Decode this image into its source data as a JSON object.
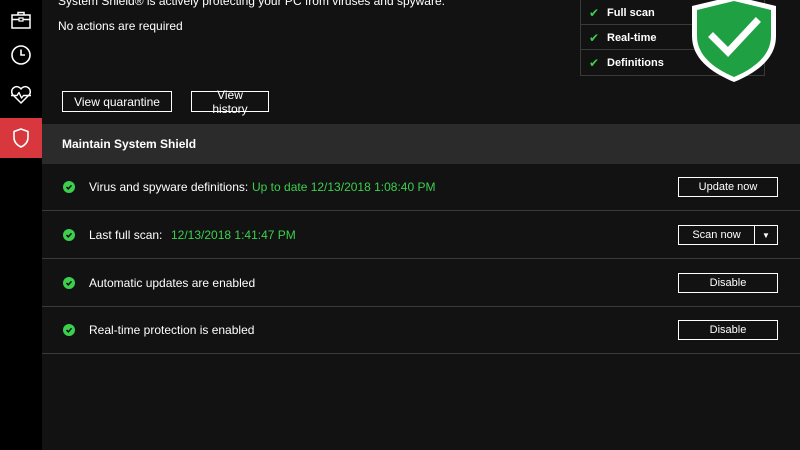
{
  "sidebar": {
    "items": [
      {
        "icon": "briefcase-icon"
      },
      {
        "icon": "clock-icon"
      },
      {
        "icon": "heartbeat-icon"
      },
      {
        "icon": "shield-icon",
        "active": true
      }
    ],
    "active_color": "#d7373d"
  },
  "status": {
    "headline": "System Shield® is actively protecting your PC from viruses and spyware.",
    "subline": "No actions are required"
  },
  "actions": {
    "view_quarantine": "View quarantine",
    "view_history": "View history"
  },
  "checklist": {
    "items": [
      "Full scan",
      "Real-time",
      "Definitions"
    ],
    "check_color": "#3ccf4e"
  },
  "section": {
    "title": "Maintain System Shield"
  },
  "rows": [
    {
      "label": "Virus and spyware definitions:",
      "value": "Up to date 12/13/2018 1:08:40 PM",
      "button": "Update now"
    },
    {
      "label": "Last full scan:",
      "value": "12/13/2018 1:41:47 PM",
      "button": "Scan now",
      "dropdown_arrow": "▼"
    },
    {
      "label": "Automatic updates are enabled",
      "value": "",
      "button": "Disable"
    },
    {
      "label": "Real-time protection is enabled",
      "value": "",
      "button": "Disable"
    }
  ],
  "colors": {
    "accent_green": "#3ccf4e",
    "background": "#121212",
    "header_bg": "#2b2b2b"
  }
}
